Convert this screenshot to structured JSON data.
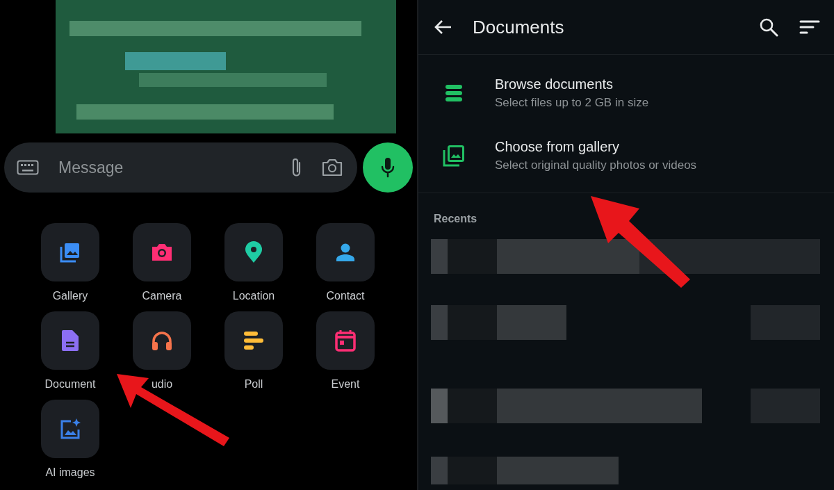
{
  "chat": {
    "message_placeholder": "Message"
  },
  "attach_menu": [
    {
      "label": "Gallery",
      "kind": "gallery",
      "color": "#3b8df5"
    },
    {
      "label": "Camera",
      "kind": "camera",
      "color": "#ff2e74"
    },
    {
      "label": "Location",
      "kind": "location",
      "color": "#1fcca4"
    },
    {
      "label": "Contact",
      "kind": "contact",
      "color": "#35a8ea"
    },
    {
      "label": "Document",
      "kind": "document",
      "color": "#8c6ff2"
    },
    {
      "label": "udio",
      "kind": "audio",
      "color": "#f5734b"
    },
    {
      "label": "Poll",
      "kind": "poll",
      "color": "#ffbc38"
    },
    {
      "label": "Event",
      "kind": "event",
      "color": "#ff2e74"
    },
    {
      "label": "AI images",
      "kind": "ai",
      "color": "#3a80e8"
    }
  ],
  "documents": {
    "title": "Documents",
    "options": [
      {
        "kind": "browse",
        "title": "Browse documents",
        "subtitle": "Select files up to 2 GB in size"
      },
      {
        "kind": "gallery",
        "title": "Choose from gallery",
        "subtitle": "Select original quality photos or videos"
      }
    ],
    "recents_heading": "Recents"
  }
}
